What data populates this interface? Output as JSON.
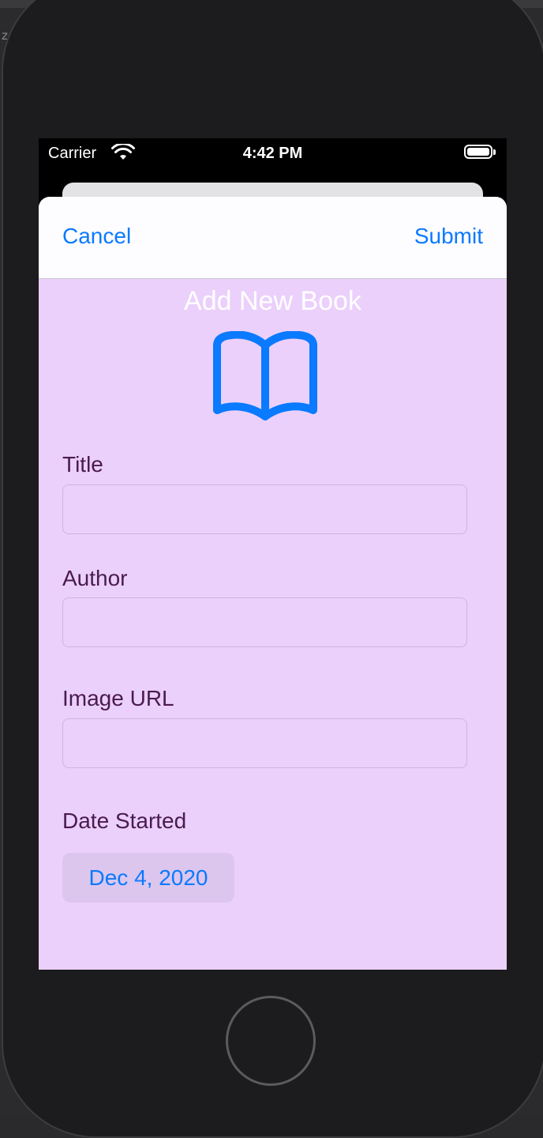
{
  "desk": {
    "corner_letter": "z"
  },
  "status_bar": {
    "carrier": "Carrier",
    "time": "4:42 PM"
  },
  "nav": {
    "cancel_label": "Cancel",
    "submit_label": "Submit"
  },
  "form": {
    "title": "Add New Book",
    "icon": "book-icon",
    "fields": [
      {
        "label": "Title",
        "value": ""
      },
      {
        "label": "Author",
        "value": ""
      },
      {
        "label": "Image URL",
        "value": ""
      }
    ],
    "date_label": "Date Started",
    "date_value": "Dec 4, 2020"
  },
  "colors": {
    "accent": "#0a7aff",
    "sheet_background": "#ebd0fb",
    "label_text": "#4a1b4e"
  }
}
